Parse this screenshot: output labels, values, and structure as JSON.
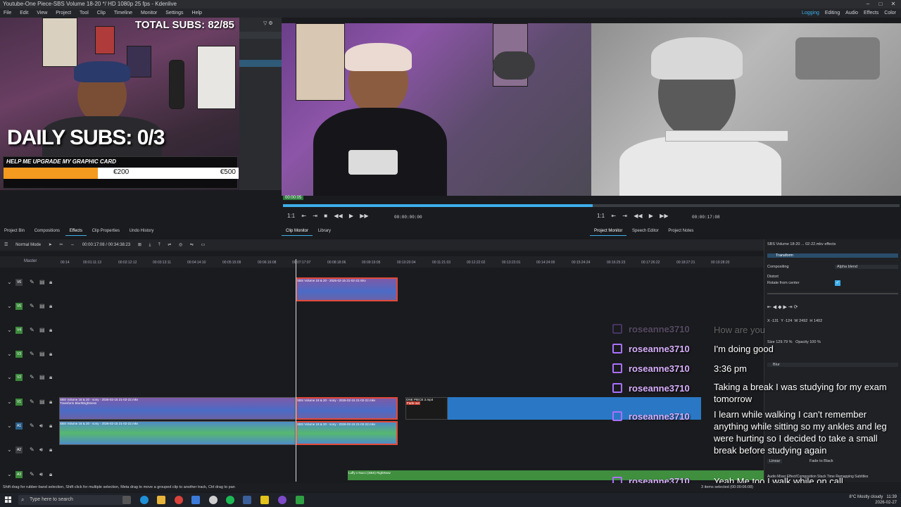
{
  "window": {
    "title": "Youtube-One Piece-SBS Volume 18-20 */ HD 1080p 25 fps - Kdenlive",
    "controls": [
      "–",
      "□",
      "✕"
    ]
  },
  "menu": {
    "items": [
      "File",
      "Edit",
      "View",
      "Project",
      "Tool",
      "Clip",
      "Timeline",
      "Monitor",
      "Settings",
      "Help"
    ],
    "workspaces": [
      "Logging",
      "Editing",
      "Audio",
      "Effects",
      "Color"
    ],
    "active_workspace": "Logging"
  },
  "overlay": {
    "total_subs": "TOTAL SUBS: 82/85",
    "daily_subs": "DAILY SUBS: 0/3",
    "goal_title": "HELP ME UPGRADE MY GRAPHIC CARD",
    "goal_current": "€200",
    "goal_max": "€500",
    "goal_progress": 0.4,
    "accent": "#f39a1f"
  },
  "monitors": {
    "clip_duration": "00:00:05",
    "clip_timecode": "00:00:00:00",
    "project_timecode": "00:00:17:08",
    "clip_zoom": "1:1",
    "project_zoom": "1:1"
  },
  "left_tabs": [
    "Project Bin",
    "Compositions",
    "Effects",
    "Clip Properties",
    "Undo History"
  ],
  "left_tabs_selected": "Effects",
  "monitor_tabs": [
    "Clip Monitor",
    "Library"
  ],
  "project_tabs": [
    "Project Monitor",
    "Speech Editor",
    "Project Notes"
  ],
  "timeline": {
    "mode": "Normal Mode",
    "timecode": "00:00:17:08 / 00:34:38:23",
    "master_label": "Master",
    "ruler_ticks": [
      "00:14",
      "00:01:11:13",
      "00:02:12:12",
      "00:03:13:11",
      "00:04:14:10",
      "00:05:15:09",
      "00:06:16:08",
      "00:07:17:07",
      "00:08:18:06",
      "00:09:19:05",
      "00:10:20:04",
      "00:11:21:03",
      "00:12:22:02",
      "00:13:23:01",
      "00:14:24:00",
      "00:15:24:24",
      "00:16:25:23",
      "00:17:26:22",
      "00:18:27:21",
      "00:19:28:20"
    ],
    "tracks": [
      "V6",
      "V5",
      "V4",
      "V3",
      "V2",
      "V1",
      "A1",
      "A2",
      "A3"
    ],
    "clip_label": "SBS Volume 18 & 20 - 2026-02-15 21-02-22.mkv",
    "clip_label_short": "SBS Volume 18 & 20 - sony - 2026-02-15 21-02-22.mkv",
    "effect_tag": "Transform  Blur/Brightness",
    "end_clip": "ONE PIECE 2.mp4",
    "end_clip_tag": "Fade out",
    "audio_tail": "Luffy x Nucci (SBS) RightNow"
  },
  "effects_panel": {
    "header": "SBS Volume 18-20 ... 02-22.mkv effects",
    "effect_name": "Transform",
    "compositing_label": "Compositing",
    "compositing_value": "Alpha blend",
    "distort_label": "Distort",
    "rotate_label": "Rotate from center",
    "rotate_checked": true,
    "pos_x": "X -131",
    "pos_y": "Y -124",
    "width": "W 2492",
    "height": "H 1402",
    "size": "Size 129.79 %",
    "opacity_label": "Opacity",
    "opacity_value": "100 %",
    "second_effect": "Blur",
    "linear_label": "Linear",
    "fade_label": "Fade to Black",
    "bottom_tabs": [
      "Audio Mixer",
      "Effect/Composition Stack",
      "Time Remapping",
      "Subtitles"
    ]
  },
  "chat": [
    {
      "user": "roseanne3710",
      "msg": "How are you"
    },
    {
      "user": "roseanne3710",
      "msg": "I'm doing good"
    },
    {
      "user": "roseanne3710",
      "msg": "3:36 pm"
    },
    {
      "user": "roseanne3710",
      "msg": "Taking a break I was studying for my exam tomorrow"
    },
    {
      "user": "roseanne3710",
      "msg": "I learn while walking I can't remember anything while sitting so my ankles and leg were hurting so I decided to take a small break before studying again"
    },
    {
      "user": "roseanne3710",
      "msg": "Yeah Me too I walk while on call"
    }
  ],
  "status": {
    "hint": "Shift drag for rubber-band selection, Shift click for multiple selection, Meta drag to move a grouped clip to another track, Ctrl drag to pan",
    "selection": "3 items selected (00:00:06:08)"
  },
  "taskbar": {
    "search_placeholder": "Type here to search",
    "weather": "8°C Mostly cloudy",
    "time": "11:39",
    "date": "2026-02-27"
  }
}
